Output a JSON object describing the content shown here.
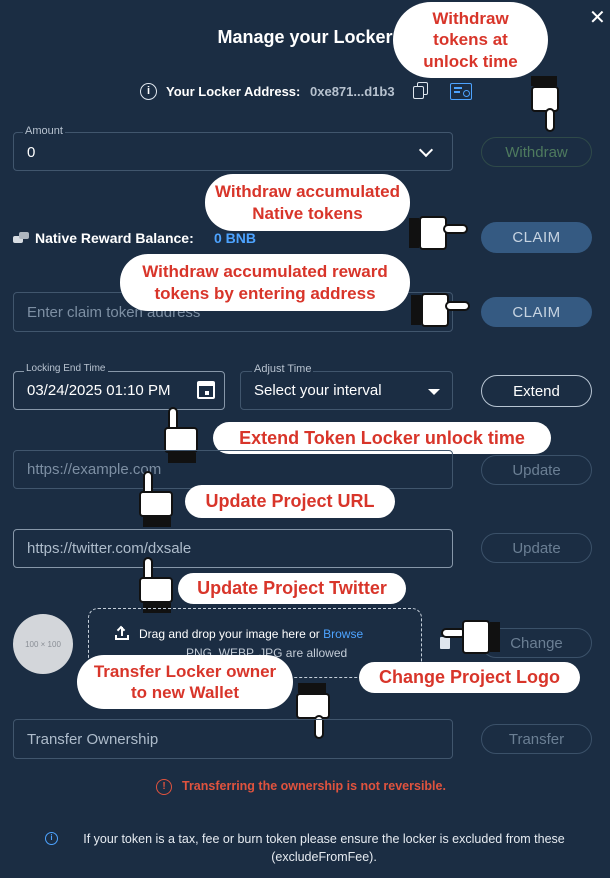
{
  "header": {
    "title": "Manage your Locker",
    "close_icon": "close-icon"
  },
  "address": {
    "label": "Your Locker Address:",
    "value": "0xe871...d1b3",
    "info_icon": "info-icon",
    "copy_icon": "copy-icon",
    "explorer_icon": "certificate-icon"
  },
  "amount": {
    "label": "Amount",
    "value": "0",
    "withdraw_label": "Withdraw"
  },
  "native_reward": {
    "label": "Native Reward Balance:",
    "value": "0 BNB",
    "claim_label": "CLAIM"
  },
  "claim_token": {
    "placeholder": "Enter claim token address",
    "claim_label": "CLAIM"
  },
  "locking": {
    "end_label": "Locking End Time",
    "end_value": "03/24/2025 01:10 PM",
    "adjust_label": "Adjust Time",
    "adjust_value": "Select your interval",
    "extend_label": "Extend"
  },
  "project_url": {
    "placeholder": "https://example.com",
    "update_label": "Update"
  },
  "twitter": {
    "placeholder": "https://twitter.com/dxsale",
    "update_label": "Update"
  },
  "logo": {
    "thumb": "100 × 100",
    "drop_text": "Drag and drop your image here or",
    "browse_label": "Browse",
    "formats": "PNG, WEBP, JPG are allowed",
    "change_label": "Change"
  },
  "transfer": {
    "placeholder": "Transfer Ownership",
    "button_label": "Transfer",
    "warning": "Transferring the ownership is not reversible."
  },
  "footer_note": "If your token is a tax, fee or burn token please ensure the locker is excluded from these (excludeFromFee).",
  "annotations": {
    "withdraw_unlock": "Withdraw tokens at unlock time",
    "withdraw_native_1": "Withdraw accumulated",
    "withdraw_native_2": "Native tokens",
    "withdraw_reward_1": "Withdraw accumulated reward",
    "withdraw_reward_2": "tokens by entering address",
    "extend": "Extend Token Locker unlock time",
    "update_url": "Update Project URL",
    "update_twitter": "Update Project Twitter",
    "transfer_1": "Transfer Locker owner",
    "transfer_2": "to new Wallet",
    "change_logo": "Change Project Logo"
  },
  "colors": {
    "background": "#1b2d43",
    "annotation_text": "#d8352a",
    "accent": "#4da3ff",
    "warning": "#e0533e"
  }
}
